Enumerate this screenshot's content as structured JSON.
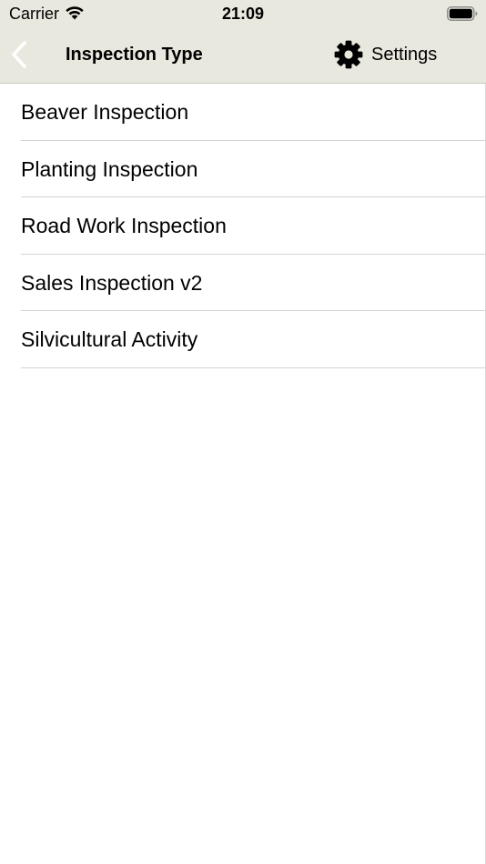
{
  "status_bar": {
    "carrier": "Carrier",
    "time": "21:09",
    "icons": [
      "wifi-icon",
      "battery-icon"
    ]
  },
  "nav": {
    "title": "Inspection Type",
    "back_icon": "chevron-left-icon",
    "settings_label": "Settings",
    "settings_icon": "gear-icon"
  },
  "inspection_types": [
    {
      "label": "Beaver Inspection"
    },
    {
      "label": "Planting Inspection"
    },
    {
      "label": "Road Work Inspection"
    },
    {
      "label": "Sales Inspection v2"
    },
    {
      "label": "Silvicultural Activity"
    }
  ],
  "colors": {
    "nav_background": "#e9e8de",
    "divider": "#d3d3d3",
    "back_chevron": "#ffffff"
  }
}
